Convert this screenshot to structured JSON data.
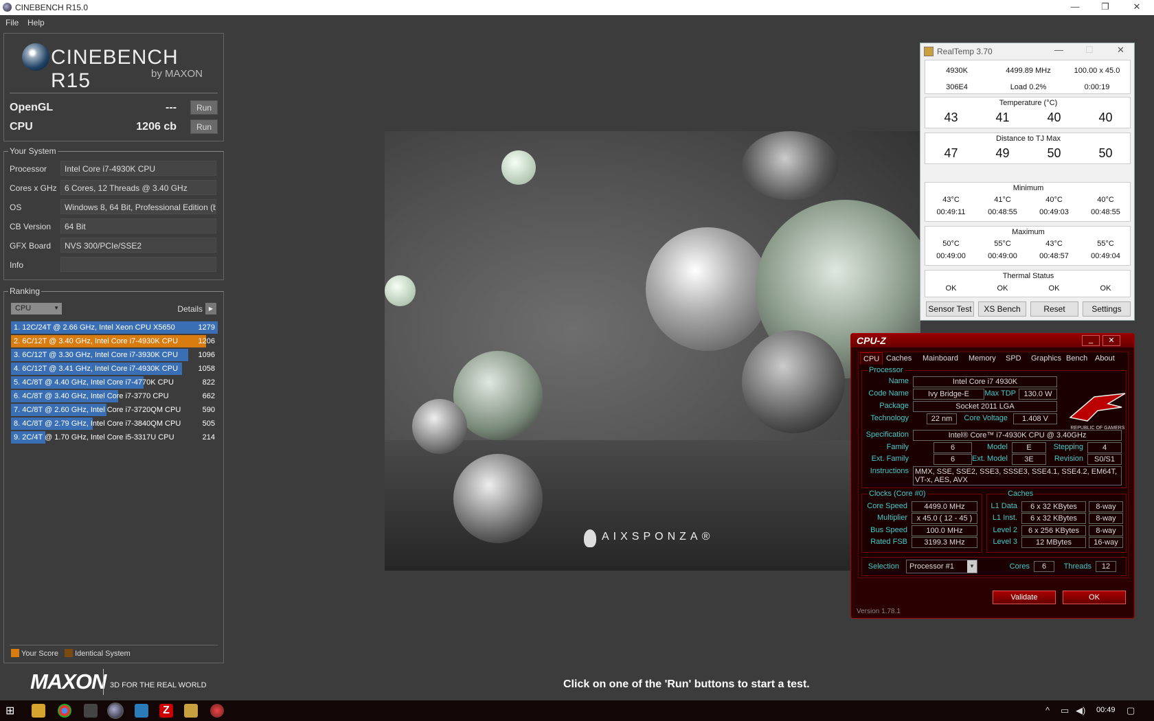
{
  "window": {
    "title": "CINEBENCH R15.0",
    "min": "—",
    "max": "❐",
    "close": "✕"
  },
  "menu": [
    "File",
    "Help"
  ],
  "logo": {
    "name": "CINEBENCH R15",
    "by": "by MAXON"
  },
  "bench": [
    {
      "label": "OpenGL",
      "value": "---",
      "btn": "Run"
    },
    {
      "label": "CPU",
      "value": "1206 cb",
      "btn": "Run"
    }
  ],
  "system": {
    "title": "Your System",
    "rows": [
      {
        "k": "Processor",
        "v": "Intel Core i7-4930K CPU"
      },
      {
        "k": "Cores x GHz",
        "v": "6 Cores, 12 Threads @ 3.40 GHz"
      },
      {
        "k": "OS",
        "v": "Windows 8, 64 Bit, Professional Edition (bui"
      },
      {
        "k": "CB Version",
        "v": "64 Bit"
      },
      {
        "k": "GFX Board",
        "v": "NVS 300/PCIe/SSE2"
      },
      {
        "k": "Info",
        "v": ""
      }
    ]
  },
  "ranking": {
    "title": "Ranking",
    "select": "CPU",
    "details": "Details",
    "max": 1279,
    "rows": [
      {
        "label": "1. 12C/24T @ 2.66 GHz, Intel Xeon CPU X5650",
        "score": 1279,
        "mine": false
      },
      {
        "label": "2. 6C/12T @ 3.40 GHz,  Intel Core i7-4930K CPU",
        "score": 1206,
        "mine": true
      },
      {
        "label": "3. 6C/12T @ 3.30 GHz,  Intel Core i7-3930K CPU",
        "score": 1096,
        "mine": false
      },
      {
        "label": "4. 6C/12T @ 3.41 GHz,  Intel Core i7-4930K CPU",
        "score": 1058,
        "mine": false
      },
      {
        "label": "5. 4C/8T @ 4.40 GHz, Intel Core i7-4770K CPU",
        "score": 822,
        "mine": false
      },
      {
        "label": "6. 4C/8T @ 3.40 GHz,  Intel Core i7-3770 CPU",
        "score": 662,
        "mine": false
      },
      {
        "label": "7. 4C/8T @ 2.60 GHz, Intel Core i7-3720QM CPU",
        "score": 590,
        "mine": false
      },
      {
        "label": "8. 4C/8T @ 2.79 GHz, Intel Core i7-3840QM CPU",
        "score": 505,
        "mine": false
      },
      {
        "label": "9. 2C/4T @ 1.70 GHz,  Intel Core i5-3317U CPU",
        "score": 214,
        "mine": false
      }
    ],
    "legend_score": "Your Score",
    "legend_identical": "Identical System"
  },
  "colors": {
    "bar": "#3a6fb5",
    "mine": "#d97c10",
    "identical": "#7a4a10"
  },
  "footer": {
    "brand": "MAXON",
    "tagline": "3D FOR THE REAL WORLD",
    "hint": "Click on one of the 'Run' buttons to start a test."
  },
  "render": {
    "brand": "AIXSPONZA®"
  },
  "realtemp": {
    "title": "RealTemp 3.70",
    "cpu": "4930K",
    "mhz": "4499.89 MHz",
    "mult": "100.00 x 45.0",
    "id": "306E4",
    "load": "Load  0.2%",
    "time": "0:00:19",
    "temp_h": "Temperature (°C)",
    "temps": [
      "43",
      "41",
      "40",
      "40"
    ],
    "dist_h": "Distance to TJ Max",
    "dist": [
      "47",
      "49",
      "50",
      "50"
    ],
    "min_h": "Minimum",
    "min_t": [
      "43°C",
      "41°C",
      "40°C",
      "40°C"
    ],
    "min_time": [
      "00:49:11",
      "00:48:55",
      "00:49:03",
      "00:48:55"
    ],
    "max_h": "Maximum",
    "max_t": [
      "50°C",
      "55°C",
      "43°C",
      "55°C"
    ],
    "max_time": [
      "00:49:00",
      "00:49:00",
      "00:48:57",
      "00:49:04"
    ],
    "status_h": "Thermal Status",
    "status": [
      "OK",
      "OK",
      "OK",
      "OK"
    ],
    "buttons": [
      "Sensor Test",
      "XS Bench",
      "Reset",
      "Settings"
    ]
  },
  "cpuz": {
    "title": "CPU-Z",
    "tabs": [
      "CPU",
      "Caches",
      "Mainboard",
      "Memory",
      "SPD",
      "Graphics",
      "Bench",
      "About"
    ],
    "proc_title": "Processor",
    "name_l": "Name",
    "name": "Intel Core i7 4930K",
    "code_l": "Code Name",
    "code": "Ivy Bridge-E",
    "tdp_l": "Max TDP",
    "tdp": "130.0 W",
    "pkg_l": "Package",
    "pkg": "Socket 2011 LGA",
    "tech_l": "Technology",
    "tech": "22 nm",
    "volt_l": "Core Voltage",
    "volt": "1.408 V",
    "spec_l": "Specification",
    "spec": "Intel® Core™ i7-4930K CPU @ 3.40GHz",
    "fam_l": "Family",
    "fam": "6",
    "model_l": "Model",
    "model": "E",
    "step_l": "Stepping",
    "step": "4",
    "efam_l": "Ext. Family",
    "efam": "6",
    "emod_l": "Ext. Model",
    "emod": "3E",
    "rev_l": "Revision",
    "rev": "S0/S1",
    "inst_l": "Instructions",
    "inst": "MMX, SSE, SSE2, SSE3, SSSE3, SSE4.1, SSE4.2, EM64T, VT-x, AES, AVX",
    "rog": "REPUBLIC OF GAMERS",
    "clk_title": "Clocks (Core #0)",
    "cs_l": "Core Speed",
    "cs": "4499.0 MHz",
    "mu_l": "Multiplier",
    "mu": "x 45.0 ( 12 - 45 )",
    "bus_l": "Bus Speed",
    "bus": "100.0 MHz",
    "fsb_l": "Rated FSB",
    "fsb": "3199.3 MHz",
    "cache_title": "Caches",
    "l1d_l": "L1 Data",
    "l1d": "6 x 32 KBytes",
    "l1d_w": "8-way",
    "l1i_l": "L1 Inst.",
    "l1i": "6 x 32 KBytes",
    "l1i_w": "8-way",
    "l2_l": "Level 2",
    "l2": "6 x 256 KBytes",
    "l2_w": "8-way",
    "l3_l": "Level 3",
    "l3": "12 MBytes",
    "l3_w": "16-way",
    "sel_l": "Selection",
    "sel": "Processor #1",
    "cores_l": "Cores",
    "cores": "6",
    "thr_l": "Threads",
    "thr": "12",
    "validate": "Validate",
    "ok": "OK",
    "version": "Version 1.78.1"
  },
  "taskbar": {
    "time": "00:49"
  }
}
